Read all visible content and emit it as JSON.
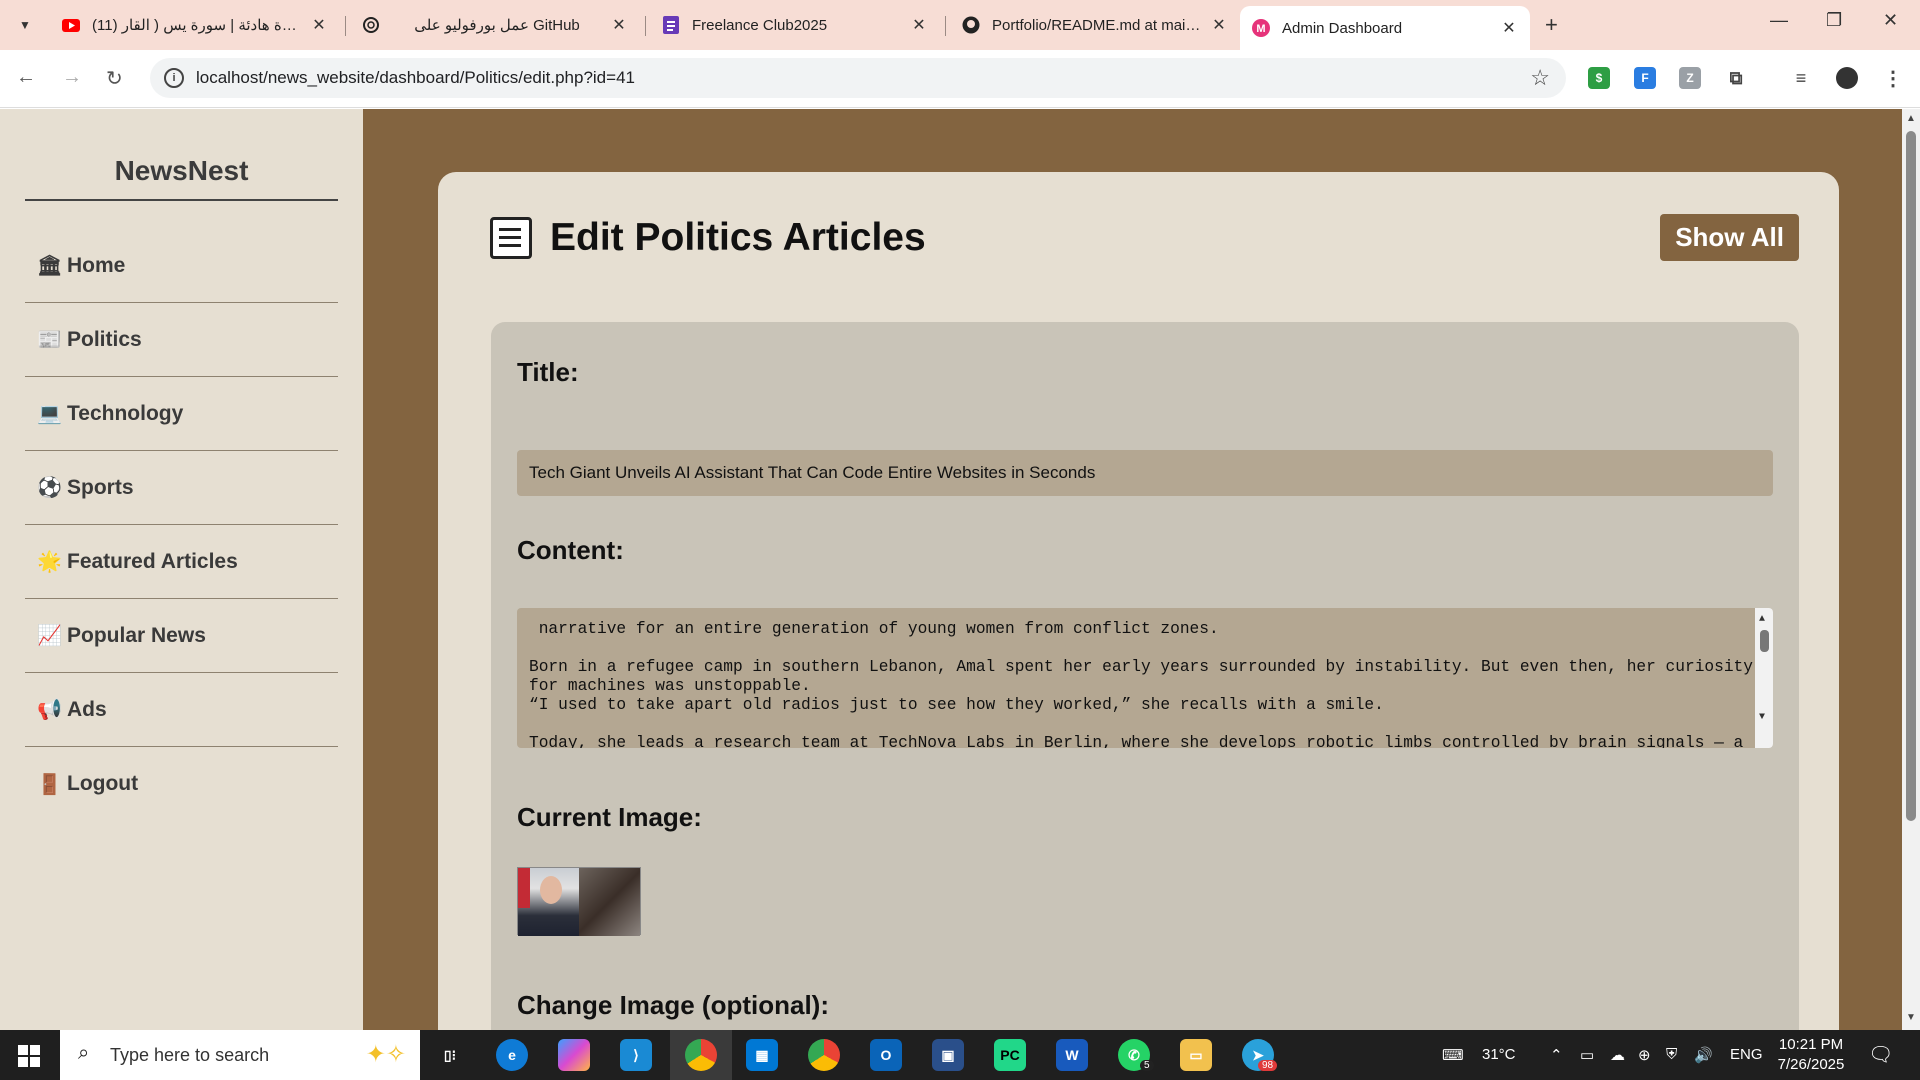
{
  "browser": {
    "tabs": [
      {
        "title": "(11) تلاوة هادئة | سورة يس ( القار",
        "icon": "youtube-icon",
        "color": "#ff0000"
      },
      {
        "title": "عمل بورفوليو على GitHub",
        "icon": "openai-icon",
        "color": "#222222"
      },
      {
        "title": "Freelance Club2025",
        "icon": "forms-icon",
        "color": "#673ab7"
      },
      {
        "title": "Portfolio/README.md at main ·",
        "icon": "github-icon",
        "color": "#222222"
      },
      {
        "title": "Admin Dashboard",
        "icon": "dashboard-icon",
        "color": "#e6337a"
      }
    ],
    "url": "localhost/news_website/dashboard/Politics/edit.php?id=41"
  },
  "sidebar": {
    "brand": "NewsNest",
    "items": [
      {
        "label": "Home",
        "icon": "🏛"
      },
      {
        "label": "Politics",
        "icon": "📰"
      },
      {
        "label": "Technology",
        "icon": "💻"
      },
      {
        "label": "Sports",
        "icon": "⚽"
      },
      {
        "label": "Featured Articles",
        "icon": "🌟"
      },
      {
        "label": "Popular News",
        "icon": "📈"
      },
      {
        "label": "Ads",
        "icon": "📢"
      },
      {
        "label": "Logout",
        "icon": "🚪"
      }
    ]
  },
  "main": {
    "heading": "Edit Politics Articles",
    "show_all": "Show All",
    "title_label": "Title:",
    "title_value": "Tech Giant Unveils AI Assistant That Can Code Entire Websites in Seconds",
    "content_label": "Content:",
    "content_lines": [
      " narrative for an entire generation of young women from conflict zones.",
      "",
      "Born in a refugee camp in southern Lebanon, Amal spent her early years surrounded by instability. But even then, her curiosity for machines was unstoppable.",
      "“I used to take apart old radios just to see how they worked,” she recalls with a smile.",
      "",
      "Today, she leads a research team at TechNova Labs in Berlin, where she develops robotic limbs controlled by brain signals — a"
    ],
    "current_image_label": "Current Image:",
    "change_image_label": "Change Image (optional):"
  },
  "taskbar": {
    "search_placeholder": "Type here to search",
    "weather": "31°C",
    "lang": "ENG",
    "time": "10:21 PM",
    "date": "7/26/2025",
    "whatsapp_badge": "5",
    "telegram_badge": "98"
  }
}
